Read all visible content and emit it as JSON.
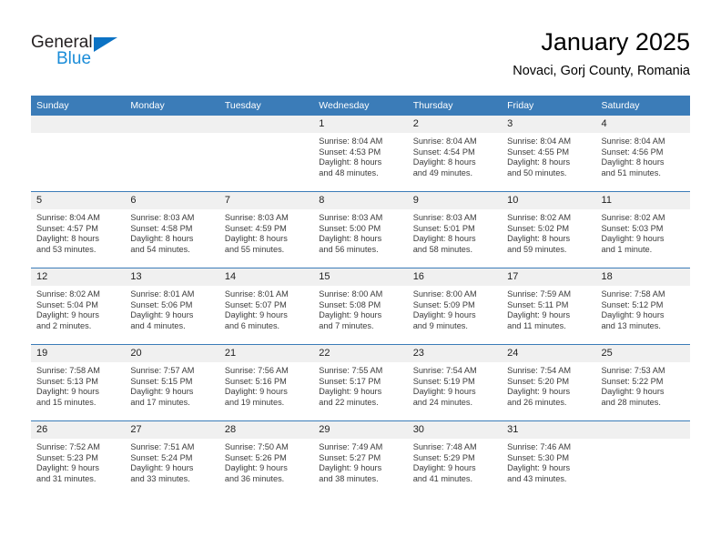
{
  "logo": {
    "word_top": "General",
    "word_bottom": "Blue",
    "triangle_color": "#0b72c4",
    "bottom_color": "#1a8cd8",
    "top_color": "#231f20"
  },
  "header": {
    "title": "January 2025",
    "subtitle": "Novaci, Gorj County, Romania"
  },
  "theme": {
    "header_blue": "#3b7cb8",
    "daynum_bg": "#f0f0f0",
    "text": "#3b3b3b"
  },
  "weekday_headers": [
    "Sunday",
    "Monday",
    "Tuesday",
    "Wednesday",
    "Thursday",
    "Friday",
    "Saturday"
  ],
  "weeks": [
    [
      {
        "day": "",
        "lines": []
      },
      {
        "day": "",
        "lines": []
      },
      {
        "day": "",
        "lines": []
      },
      {
        "day": "1",
        "lines": [
          "Sunrise: 8:04 AM",
          "Sunset: 4:53 PM",
          "Daylight: 8 hours",
          "and 48 minutes."
        ]
      },
      {
        "day": "2",
        "lines": [
          "Sunrise: 8:04 AM",
          "Sunset: 4:54 PM",
          "Daylight: 8 hours",
          "and 49 minutes."
        ]
      },
      {
        "day": "3",
        "lines": [
          "Sunrise: 8:04 AM",
          "Sunset: 4:55 PM",
          "Daylight: 8 hours",
          "and 50 minutes."
        ]
      },
      {
        "day": "4",
        "lines": [
          "Sunrise: 8:04 AM",
          "Sunset: 4:56 PM",
          "Daylight: 8 hours",
          "and 51 minutes."
        ]
      }
    ],
    [
      {
        "day": "5",
        "lines": [
          "Sunrise: 8:04 AM",
          "Sunset: 4:57 PM",
          "Daylight: 8 hours",
          "and 53 minutes."
        ]
      },
      {
        "day": "6",
        "lines": [
          "Sunrise: 8:03 AM",
          "Sunset: 4:58 PM",
          "Daylight: 8 hours",
          "and 54 minutes."
        ]
      },
      {
        "day": "7",
        "lines": [
          "Sunrise: 8:03 AM",
          "Sunset: 4:59 PM",
          "Daylight: 8 hours",
          "and 55 minutes."
        ]
      },
      {
        "day": "8",
        "lines": [
          "Sunrise: 8:03 AM",
          "Sunset: 5:00 PM",
          "Daylight: 8 hours",
          "and 56 minutes."
        ]
      },
      {
        "day": "9",
        "lines": [
          "Sunrise: 8:03 AM",
          "Sunset: 5:01 PM",
          "Daylight: 8 hours",
          "and 58 minutes."
        ]
      },
      {
        "day": "10",
        "lines": [
          "Sunrise: 8:02 AM",
          "Sunset: 5:02 PM",
          "Daylight: 8 hours",
          "and 59 minutes."
        ]
      },
      {
        "day": "11",
        "lines": [
          "Sunrise: 8:02 AM",
          "Sunset: 5:03 PM",
          "Daylight: 9 hours",
          "and 1 minute."
        ]
      }
    ],
    [
      {
        "day": "12",
        "lines": [
          "Sunrise: 8:02 AM",
          "Sunset: 5:04 PM",
          "Daylight: 9 hours",
          "and 2 minutes."
        ]
      },
      {
        "day": "13",
        "lines": [
          "Sunrise: 8:01 AM",
          "Sunset: 5:06 PM",
          "Daylight: 9 hours",
          "and 4 minutes."
        ]
      },
      {
        "day": "14",
        "lines": [
          "Sunrise: 8:01 AM",
          "Sunset: 5:07 PM",
          "Daylight: 9 hours",
          "and 6 minutes."
        ]
      },
      {
        "day": "15",
        "lines": [
          "Sunrise: 8:00 AM",
          "Sunset: 5:08 PM",
          "Daylight: 9 hours",
          "and 7 minutes."
        ]
      },
      {
        "day": "16",
        "lines": [
          "Sunrise: 8:00 AM",
          "Sunset: 5:09 PM",
          "Daylight: 9 hours",
          "and 9 minutes."
        ]
      },
      {
        "day": "17",
        "lines": [
          "Sunrise: 7:59 AM",
          "Sunset: 5:11 PM",
          "Daylight: 9 hours",
          "and 11 minutes."
        ]
      },
      {
        "day": "18",
        "lines": [
          "Sunrise: 7:58 AM",
          "Sunset: 5:12 PM",
          "Daylight: 9 hours",
          "and 13 minutes."
        ]
      }
    ],
    [
      {
        "day": "19",
        "lines": [
          "Sunrise: 7:58 AM",
          "Sunset: 5:13 PM",
          "Daylight: 9 hours",
          "and 15 minutes."
        ]
      },
      {
        "day": "20",
        "lines": [
          "Sunrise: 7:57 AM",
          "Sunset: 5:15 PM",
          "Daylight: 9 hours",
          "and 17 minutes."
        ]
      },
      {
        "day": "21",
        "lines": [
          "Sunrise: 7:56 AM",
          "Sunset: 5:16 PM",
          "Daylight: 9 hours",
          "and 19 minutes."
        ]
      },
      {
        "day": "22",
        "lines": [
          "Sunrise: 7:55 AM",
          "Sunset: 5:17 PM",
          "Daylight: 9 hours",
          "and 22 minutes."
        ]
      },
      {
        "day": "23",
        "lines": [
          "Sunrise: 7:54 AM",
          "Sunset: 5:19 PM",
          "Daylight: 9 hours",
          "and 24 minutes."
        ]
      },
      {
        "day": "24",
        "lines": [
          "Sunrise: 7:54 AM",
          "Sunset: 5:20 PM",
          "Daylight: 9 hours",
          "and 26 minutes."
        ]
      },
      {
        "day": "25",
        "lines": [
          "Sunrise: 7:53 AM",
          "Sunset: 5:22 PM",
          "Daylight: 9 hours",
          "and 28 minutes."
        ]
      }
    ],
    [
      {
        "day": "26",
        "lines": [
          "Sunrise: 7:52 AM",
          "Sunset: 5:23 PM",
          "Daylight: 9 hours",
          "and 31 minutes."
        ]
      },
      {
        "day": "27",
        "lines": [
          "Sunrise: 7:51 AM",
          "Sunset: 5:24 PM",
          "Daylight: 9 hours",
          "and 33 minutes."
        ]
      },
      {
        "day": "28",
        "lines": [
          "Sunrise: 7:50 AM",
          "Sunset: 5:26 PM",
          "Daylight: 9 hours",
          "and 36 minutes."
        ]
      },
      {
        "day": "29",
        "lines": [
          "Sunrise: 7:49 AM",
          "Sunset: 5:27 PM",
          "Daylight: 9 hours",
          "and 38 minutes."
        ]
      },
      {
        "day": "30",
        "lines": [
          "Sunrise: 7:48 AM",
          "Sunset: 5:29 PM",
          "Daylight: 9 hours",
          "and 41 minutes."
        ]
      },
      {
        "day": "31",
        "lines": [
          "Sunrise: 7:46 AM",
          "Sunset: 5:30 PM",
          "Daylight: 9 hours",
          "and 43 minutes."
        ]
      },
      {
        "day": "",
        "lines": []
      }
    ]
  ]
}
